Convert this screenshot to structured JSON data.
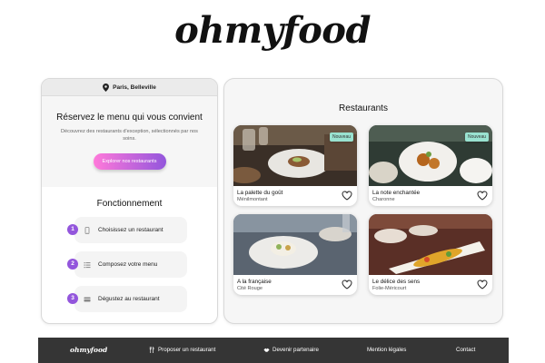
{
  "brand": {
    "logo": "ohmyfood",
    "footer_logo": "ohmyfood"
  },
  "location": {
    "text": "Paris, Belleville",
    "icon": "location-pin-icon"
  },
  "hero": {
    "title": "Réservez le menu qui vous convient",
    "subtitle": "Découvrez des restaurants d'exception, sélectionnés par nos soins.",
    "button": "Explorer nos restaurants"
  },
  "how": {
    "title": "Fonctionnement",
    "steps": [
      {
        "num": "1",
        "label": "Choisissez un restaurant",
        "icon": "mobile-icon"
      },
      {
        "num": "2",
        "label": "Composez votre menu",
        "icon": "list-icon"
      },
      {
        "num": "3",
        "label": "Dégustez au restaurant",
        "icon": "tray-icon"
      }
    ]
  },
  "restaurants": {
    "title": "Restaurants",
    "items": [
      {
        "name": "La palette du goût",
        "area": "Ménilmontant",
        "badge": "Nouveau"
      },
      {
        "name": "La note enchantée",
        "area": "Charonne",
        "badge": "Nouveau"
      },
      {
        "name": "A la française",
        "area": "Cité Rouge",
        "badge": ""
      },
      {
        "name": "Le délice des sens",
        "area": "Folie-Méricourt",
        "badge": ""
      }
    ]
  },
  "footer": {
    "items": [
      {
        "label": "Proposer un restaurant",
        "icon": "cutlery-icon"
      },
      {
        "label": "Devenir partenaire",
        "icon": "handshake-icon"
      },
      {
        "label": "Mention légales",
        "icon": ""
      },
      {
        "label": "Contact",
        "icon": ""
      }
    ]
  },
  "colors": {
    "accent_start": "#ff79da",
    "accent_end": "#9356dc",
    "badge": "#99e2d0",
    "footer_bg": "#353535"
  }
}
